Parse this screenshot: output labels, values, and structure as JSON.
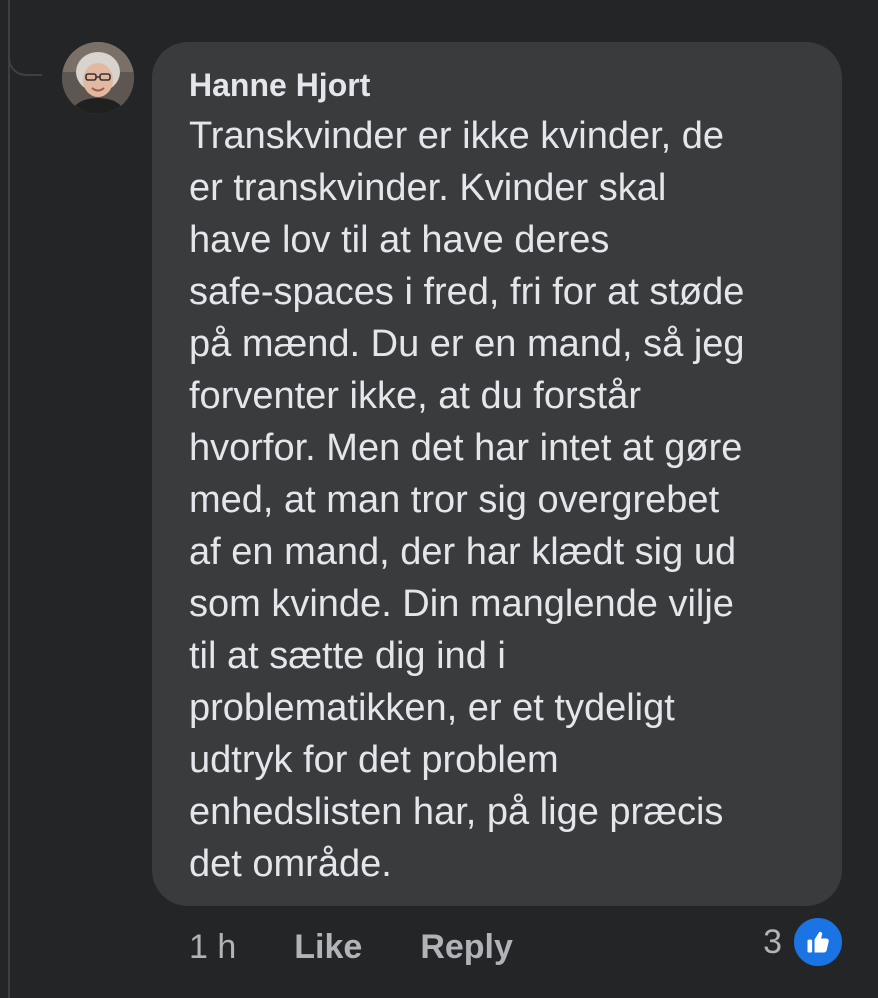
{
  "comment": {
    "author": "Hanne Hjort",
    "text": "Transkvinder er ikke kvinder, de\ner transkvinder. Kvinder skal\nhave lov til at have deres\nsafe-spaces i fred, fri for at støde\npå mænd. Du er en mand, så jeg\nforventer ikke, at du forstår\nhvorfor. Men det har intet at gøre\nmed, at man tror sig overgrebet\naf en mand, der har klædt sig ud\nsom kvinde. Din manglende vilje\ntil at sætte dig ind i\nproblematikken, er et tydeligt\nudtryk for det problem\nenhedslisten har, på lige præcis\ndet område.",
    "timestamp": "1 h",
    "like_label": "Like",
    "reply_label": "Reply",
    "reaction_count": "3",
    "reaction_icon": "thumbs-up-icon"
  },
  "colors": {
    "background": "#242526",
    "bubble": "#3a3b3c",
    "primary_text": "#e4e6eb",
    "secondary_text": "#b0b3b8",
    "like_badge": "#1b74e4"
  }
}
